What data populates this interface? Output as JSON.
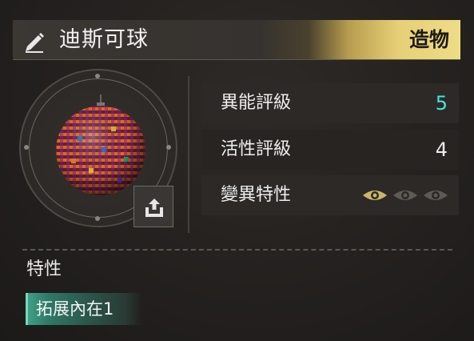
{
  "header": {
    "name": "迪斯可球",
    "type": "造物"
  },
  "stats": [
    {
      "label": "異能評級",
      "value": "5",
      "color": "#47e3d8"
    },
    {
      "label": "活性評級",
      "value": "4",
      "color": "#ececec"
    },
    {
      "label": "變異特性",
      "eyes_total": 3,
      "eyes_active": 1
    }
  ],
  "traits": {
    "title": "特性",
    "items": [
      "拓展內在1"
    ]
  },
  "colors": {
    "accent_gold": "#e6cf76",
    "accent_cyan": "#47e3d8",
    "trait_green": "#3f9f86"
  }
}
